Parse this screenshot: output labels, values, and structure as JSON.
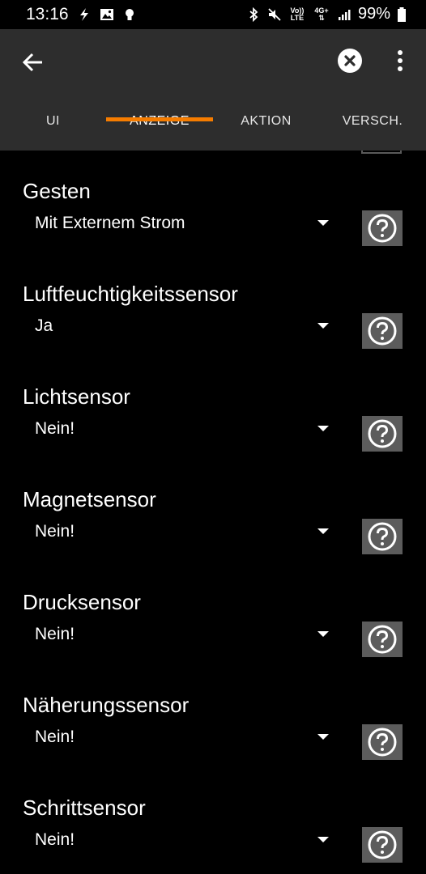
{
  "status_bar": {
    "time": "13:16",
    "battery": "99%",
    "network_label": "4G+",
    "volte_label_top": "Vo))",
    "volte_label_bottom": "LTE"
  },
  "app_bar": {
    "tabs": [
      {
        "label": "UI"
      },
      {
        "label": "ANZEIGE"
      },
      {
        "label": "AKTION"
      },
      {
        "label": "VERSCH."
      }
    ],
    "active_tab": "ANZEIGE"
  },
  "colors": {
    "accent": "#f57c00",
    "app_bar_bg": "#2d2d2d",
    "background": "#000000",
    "help_button_bg": "#5c5c5c"
  },
  "settings": [
    {
      "title": "Gesten",
      "value": "Mit Externem Strom",
      "help_icon": "question-circle-icon"
    },
    {
      "title": "Luftfeuchtigkeitssensor",
      "value": "Ja",
      "help_icon": "question-circle-icon"
    },
    {
      "title": "Lichtsensor",
      "value": "Nein!",
      "help_icon": "question-circle-icon"
    },
    {
      "title": "Magnetsensor",
      "value": "Nein!",
      "help_icon": "question-circle-icon"
    },
    {
      "title": "Drucksensor",
      "value": "Nein!",
      "help_icon": "question-circle-icon"
    },
    {
      "title": "Näherungssensor",
      "value": "Nein!",
      "help_icon": "question-circle-icon"
    },
    {
      "title": "Schrittsensor",
      "value": "Nein!",
      "help_icon": "question-circle-icon"
    }
  ]
}
